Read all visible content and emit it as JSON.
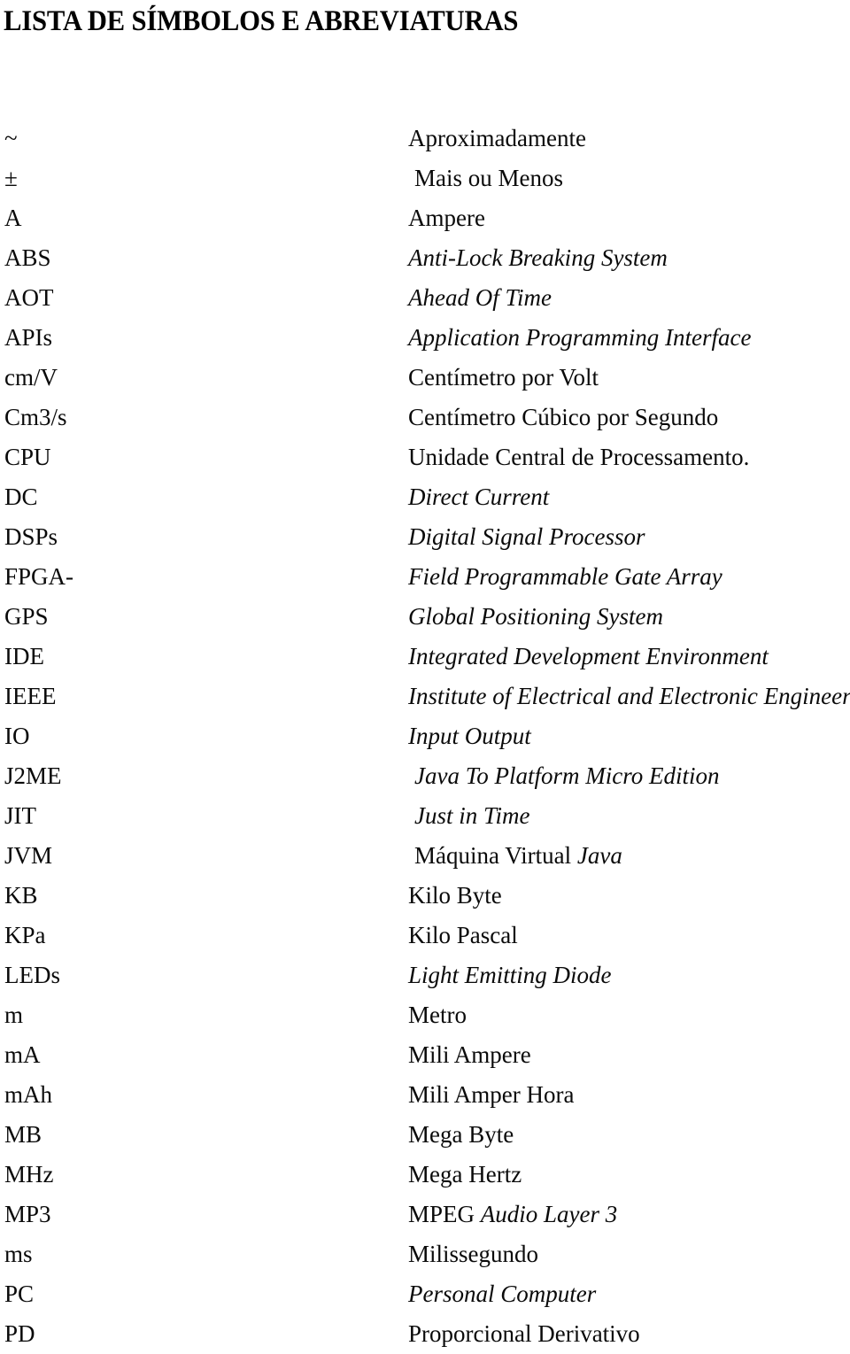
{
  "document": {
    "title": "LISTA DE SÍMBOLOS E ABREVIATURAS",
    "language": "pt-BR",
    "text_color": "#0a0a0a",
    "background_color": "#ffffff"
  },
  "list": {
    "rows": [
      {
        "symbol": "~",
        "definition": "Aproximadamente",
        "style": "roman",
        "indent": false
      },
      {
        "symbol": "±",
        "definition": "Mais ou Menos",
        "style": "roman",
        "indent": true
      },
      {
        "symbol": "A",
        "definition": "Ampere",
        "style": "roman",
        "indent": false
      },
      {
        "symbol": "ABS",
        "definition": "Anti-Lock Breaking System",
        "style": "italic",
        "indent": false
      },
      {
        "symbol": "AOT",
        "definition": "Ahead Of Time",
        "style": "italic",
        "indent": false
      },
      {
        "symbol": "APIs",
        "definition": "Application Programming Interface",
        "style": "italic",
        "indent": false
      },
      {
        "symbol": "cm/V",
        "definition": "Centímetro por Volt",
        "style": "roman",
        "indent": false
      },
      {
        "symbol": "Cm3/s",
        "definition": "Centímetro Cúbico por Segundo",
        "style": "roman",
        "indent": false
      },
      {
        "symbol": "CPU",
        "definition": "Unidade Central de Processamento.",
        "style": "roman",
        "indent": false
      },
      {
        "symbol": "DC",
        "definition": "Direct Current",
        "style": "italic",
        "indent": false
      },
      {
        "symbol": "DSPs",
        "definition": "Digital Signal Processor",
        "style": "italic",
        "indent": false
      },
      {
        "symbol": "FPGA-",
        "definition": "Field Programmable Gate Array",
        "style": "italic",
        "indent": false
      },
      {
        "symbol": "GPS",
        "definition": "Global Positioning System",
        "style": "italic",
        "indent": false
      },
      {
        "symbol": "IDE",
        "definition": "Integrated Development Environment",
        "style": "italic",
        "indent": false
      },
      {
        "symbol": "IEEE",
        "definition": "Institute of Electrical and Electronic Engineers",
        "style": "italic",
        "indent": false
      },
      {
        "symbol": "IO",
        "definition": "Input Output",
        "style": "italic",
        "indent": false
      },
      {
        "symbol": "J2ME",
        "definition": "Java To Platform Micro Edition",
        "style": "italic",
        "indent": true
      },
      {
        "symbol": "JIT",
        "definition": "Just in Time",
        "style": "italic",
        "indent": true
      },
      {
        "symbol": "JVM",
        "definition": "Máquina Virtual Java",
        "style": "mixed",
        "indent": true,
        "parts": [
          {
            "text": "Máquina Virtual ",
            "style": "roman"
          },
          {
            "text": "Java",
            "style": "italic"
          }
        ]
      },
      {
        "symbol": "KB",
        "definition": "Kilo Byte",
        "style": "roman",
        "indent": false
      },
      {
        "symbol": "KPa",
        "definition": "Kilo Pascal",
        "style": "roman",
        "indent": false
      },
      {
        "symbol": "LEDs",
        "definition": "Light Emitting Diode",
        "style": "italic",
        "indent": false
      },
      {
        "symbol": "m",
        "definition": "Metro",
        "style": "roman",
        "indent": false
      },
      {
        "symbol": "mA",
        "definition": "Mili Ampere",
        "style": "roman",
        "indent": false
      },
      {
        "symbol": "mAh",
        "definition": "Mili Amper Hora",
        "style": "roman",
        "indent": false
      },
      {
        "symbol": "MB",
        "definition": "Mega Byte",
        "style": "roman",
        "indent": false
      },
      {
        "symbol": "MHz",
        "definition": "Mega Hertz",
        "style": "roman",
        "indent": false
      },
      {
        "symbol": "MP3",
        "definition": "MPEG Audio Layer 3",
        "style": "mixed",
        "indent": false,
        "parts": [
          {
            "text": "MPEG ",
            "style": "roman"
          },
          {
            "text": "Audio Layer 3",
            "style": "italic"
          }
        ]
      },
      {
        "symbol": "ms",
        "definition": "Milissegundo",
        "style": "roman",
        "indent": false
      },
      {
        "symbol": "PC",
        "definition": "Personal Computer",
        "style": "italic",
        "indent": false
      },
      {
        "symbol": "PD",
        "definition": "Proporcional Derivativo",
        "style": "roman",
        "indent": false
      }
    ]
  }
}
